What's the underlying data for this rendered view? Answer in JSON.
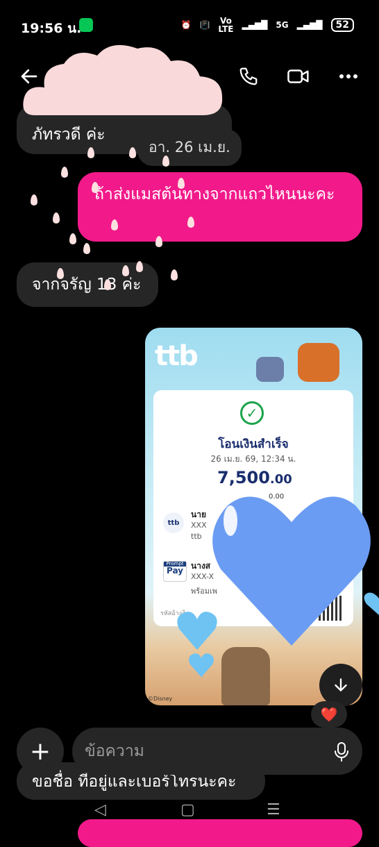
{
  "status_bar": {
    "time": "19:56 น.",
    "network_label_top": "Vo",
    "network_label_bottom": "LTE",
    "fiveg_label": "5G",
    "battery": "52"
  },
  "date_chip": "อา. 26 เม.ย.",
  "messages": [
    {
      "side": "in",
      "text": "ภัทรวดี ค่ะ"
    },
    {
      "side": "out",
      "text": "ถ้าส่งแมสต้นทางจากแถวไหนนะคะ"
    },
    {
      "side": "in",
      "text": "จากจรัญ 13 ค่ะ"
    },
    {
      "side": "in",
      "text": "ขอชื่อ ที่อยู่และเบอร์โทรนะคะ"
    }
  ],
  "slip": {
    "brand": "ttb",
    "status": "โอนเงินสำเร็จ",
    "datetime": "26 เม.ย. 69, 12:34 น.",
    "amount": "7,500",
    "amount_decimals": ".00",
    "fee": "0.00",
    "from_prefix": "นาย",
    "from_masked": "XXX",
    "from_bank": "ttb",
    "to_prefix": "นางส",
    "to_masked": "XXX-X",
    "to_note": "พร้อมเพ",
    "ref_label": "รหัสอ้างอิง",
    "promptpay_top": "Prompt",
    "promptpay_bottom": "Pay",
    "disney": "©Disney"
  },
  "reaction": "❤️",
  "composer": {
    "placeholder": "ข้อความ"
  },
  "colors": {
    "accent": "#f21a8a",
    "bubble_in": "#262626",
    "background": "#000000"
  }
}
